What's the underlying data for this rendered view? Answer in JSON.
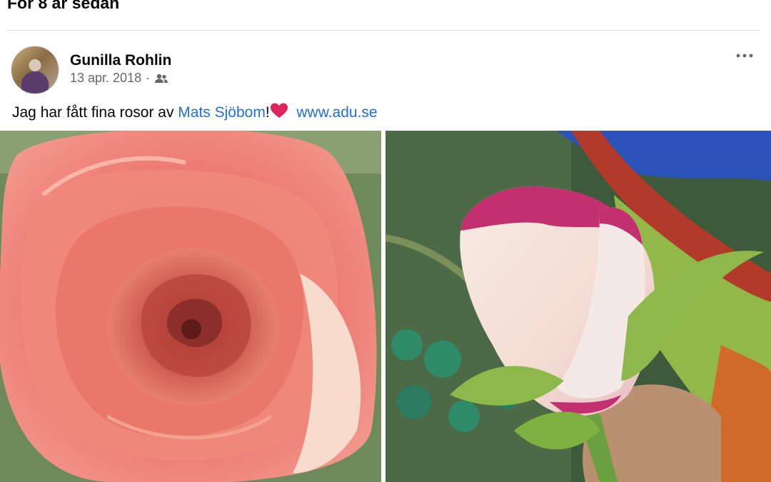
{
  "memory_header": {
    "title": "För 8 år sedan"
  },
  "post": {
    "author": "Gunilla Rohlin",
    "date": "13 apr. 2018",
    "separator": "·",
    "audience_icon": "friends-icon",
    "more_icon": "more-options-icon",
    "text_before": "Jag har fått fina rosor av ",
    "mention": "Mats Sjöbom",
    "exclamation": "!",
    "emoji": "red-heart-emoji",
    "link": "www.adu.se",
    "photos": [
      {
        "subject": "pink-rose-bloom"
      },
      {
        "subject": "white-pink-rosebud"
      }
    ]
  },
  "colors": {
    "link": "#216fdb",
    "meta_text": "#65676b",
    "heart": "#e0245e"
  }
}
